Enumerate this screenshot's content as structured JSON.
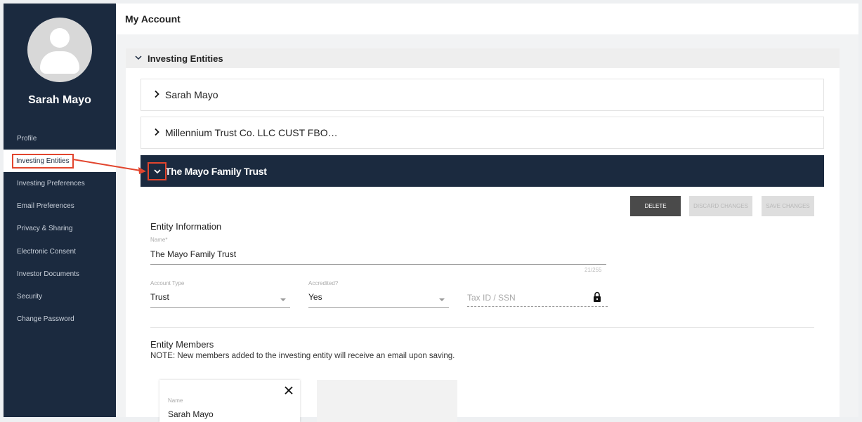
{
  "page_title": "My Account",
  "sidebar": {
    "user_name": "Sarah Mayo",
    "items": [
      {
        "label": "Profile"
      },
      {
        "label": "Investing Entities",
        "active": true
      },
      {
        "label": "Investing Preferences"
      },
      {
        "label": "Email Preferences"
      },
      {
        "label": "Privacy & Sharing"
      },
      {
        "label": "Electronic Consent"
      },
      {
        "label": "Investor Documents"
      },
      {
        "label": "Security"
      },
      {
        "label": "Change Password"
      }
    ]
  },
  "section": {
    "title": "Investing Entities",
    "entities": [
      {
        "name": "Sarah Mayo"
      },
      {
        "name": "Millennium Trust Co. LLC CUST FBO…"
      },
      {
        "name": "The Mayo Family Trust"
      }
    ]
  },
  "actions": {
    "delete": "DELETE",
    "discard": "DISCARD CHANGES",
    "save": "SAVE CHANGES"
  },
  "entity_info": {
    "heading": "Entity Information",
    "name_label": "Name*",
    "name_value": "The Mayo Family Trust",
    "name_counter": "21/255",
    "account_type_label": "Account Type",
    "account_type_value": "Trust",
    "accredited_label": "Accredited?",
    "accredited_value": "Yes",
    "tax_placeholder": "Tax ID / SSN"
  },
  "members": {
    "heading": "Entity Members",
    "note": "NOTE: New members added to the investing entity will receive an email upon saving.",
    "card_label": "Name",
    "card_value": "Sarah Mayo"
  },
  "colors": {
    "sidebar_bg": "#1b2a3f",
    "highlight": "#e2452e"
  }
}
